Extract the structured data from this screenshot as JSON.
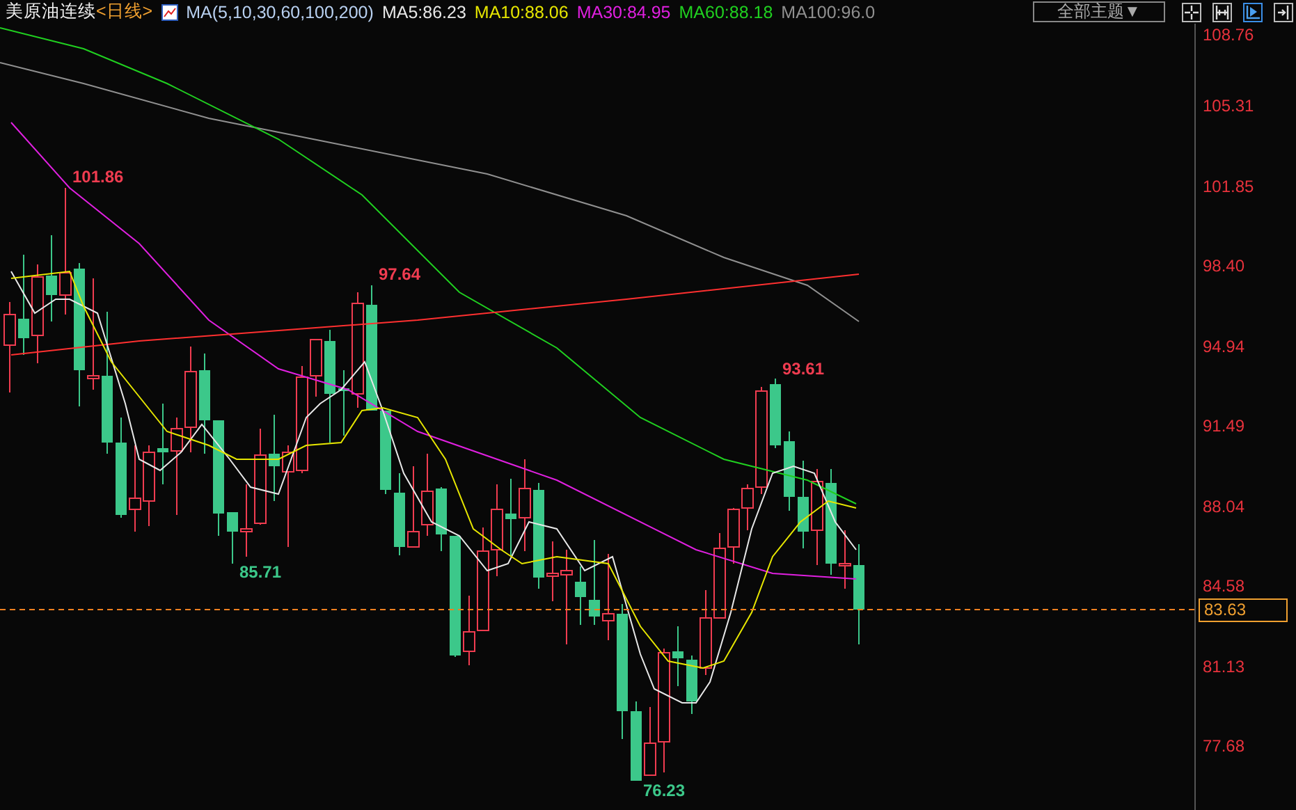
{
  "header": {
    "instrument": "美原油连续",
    "period": "<日线>",
    "indicator": "MA(5,10,30,60,100,200)",
    "ma_values": [
      {
        "label": "MA5:86.23",
        "color": "#e8e8e8"
      },
      {
        "label": "MA10:88.06",
        "color": "#e6e600"
      },
      {
        "label": "MA30:84.95",
        "color": "#e020e0"
      },
      {
        "label": "MA60:88.18",
        "color": "#20d020"
      },
      {
        "label": "MA100:96.0",
        "color": "#909090"
      }
    ],
    "theme_select": "全部主题▼",
    "tool_buttons": [
      {
        "kind": "crosshair",
        "selected": false
      },
      {
        "kind": "fit",
        "selected": false
      },
      {
        "kind": "play",
        "selected": true
      },
      {
        "kind": "end",
        "selected": false
      }
    ]
  },
  "price_axis": {
    "labels": [
      "108.76",
      "105.31",
      "101.85",
      "98.40",
      "94.94",
      "91.49",
      "88.04",
      "84.58",
      "81.13",
      "77.68"
    ],
    "current_price": "83.63"
  },
  "annotations": [
    {
      "text": "101.86",
      "kind": "high"
    },
    {
      "text": "97.64",
      "kind": "high"
    },
    {
      "text": "93.61",
      "kind": "high"
    },
    {
      "text": "85.71",
      "kind": "low"
    },
    {
      "text": "76.23",
      "kind": "low"
    }
  ]
}
